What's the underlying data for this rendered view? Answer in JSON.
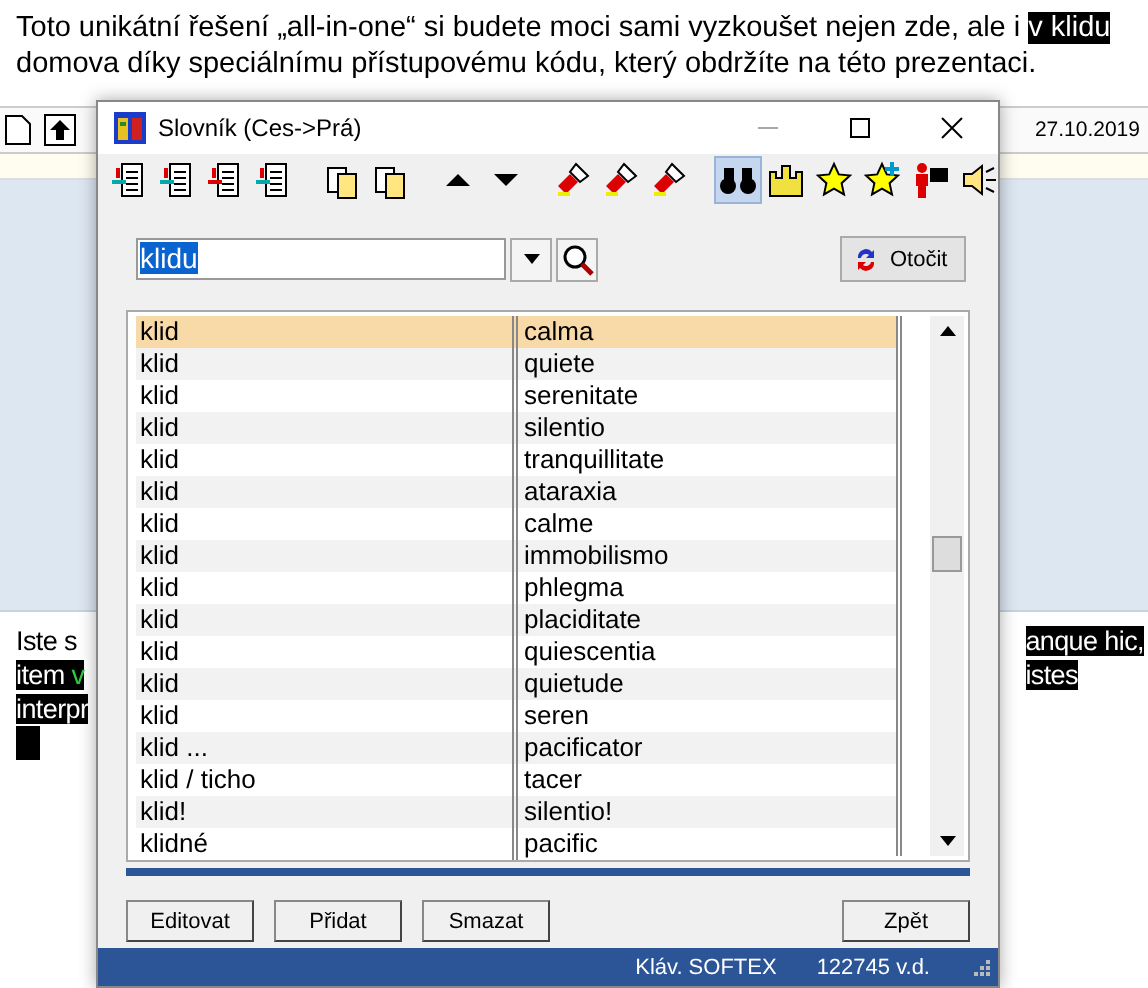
{
  "document": {
    "intro_lines": [
      [
        {
          "text": "Toto unikátní řešení „all-in-one“ si budete moci sami vyzkoušet nejen zde, ale i ",
          "highlighted": false
        },
        {
          "text": "v klidu",
          "highlighted": true
        }
      ],
      [
        {
          "text": "domova díky speciálnímu přístupovému kódu, který obdržíte na této prezentaci.",
          "highlighted": false
        }
      ]
    ],
    "date": "27.10.2019",
    "left_fragments": [
      [
        {
          "text": "Iste s",
          "highlighted": false
        }
      ],
      [
        {
          "text": "item ",
          "highlighted": true
        },
        {
          "text": "v",
          "highlighted": true,
          "green": true
        }
      ],
      [
        {
          "text": "interpr",
          "highlighted": true
        }
      ]
    ],
    "right_fragments": [
      "anque hic,",
      "istes"
    ]
  },
  "dialog": {
    "title": "Slovník (Ces->Prá)",
    "tool_groups": [
      [
        {
          "kind": "doc-in",
          "selected": false
        },
        {
          "kind": "doc-out",
          "selected": false
        },
        {
          "kind": "doc-del",
          "selected": false
        },
        {
          "kind": "doc-swap",
          "selected": false
        }
      ],
      [
        {
          "kind": "copy",
          "selected": false
        },
        {
          "kind": "copy",
          "selected": false
        }
      ],
      [
        {
          "kind": "up",
          "selected": false
        },
        {
          "kind": "down",
          "selected": false
        }
      ],
      [
        {
          "kind": "torch",
          "selected": false
        },
        {
          "kind": "torch",
          "selected": false
        },
        {
          "kind": "torch",
          "selected": false
        }
      ],
      [
        {
          "kind": "binoculars",
          "selected": true
        },
        {
          "kind": "castle",
          "selected": false
        },
        {
          "kind": "star",
          "selected": false
        },
        {
          "kind": "star-plus",
          "selected": false
        },
        {
          "kind": "person",
          "selected": false
        },
        {
          "kind": "speaker",
          "selected": false
        }
      ]
    ],
    "search_value": "klidu",
    "swap_button": "Otočit",
    "rows": [
      {
        "term": "klid",
        "translation": "calma",
        "selected": true
      },
      {
        "term": "klid",
        "translation": "quiete",
        "selected": false
      },
      {
        "term": "klid",
        "translation": "serenitate",
        "selected": false
      },
      {
        "term": "klid",
        "translation": "silentio",
        "selected": false
      },
      {
        "term": "klid",
        "translation": "tranquillitate",
        "selected": false
      },
      {
        "term": "klid",
        "translation": "ataraxia",
        "selected": false
      },
      {
        "term": "klid",
        "translation": "calme",
        "selected": false
      },
      {
        "term": "klid",
        "translation": "immobilismo",
        "selected": false
      },
      {
        "term": "klid",
        "translation": "phlegma",
        "selected": false
      },
      {
        "term": "klid",
        "translation": "placiditate",
        "selected": false
      },
      {
        "term": "klid",
        "translation": "quiescentia",
        "selected": false
      },
      {
        "term": "klid",
        "translation": "quietude",
        "selected": false
      },
      {
        "term": "klid",
        "translation": "seren",
        "selected": false
      },
      {
        "term": "klid ...",
        "translation": "pacificator",
        "selected": false
      },
      {
        "term": "klid / ticho",
        "translation": "tacer",
        "selected": false
      },
      {
        "term": "klid!",
        "translation": "silentio!",
        "selected": false
      },
      {
        "term": "klidné",
        "translation": "pacific",
        "selected": false
      }
    ],
    "buttons": [
      "Editovat",
      "Přidat",
      "Smazat"
    ],
    "back_button": "Zpět",
    "status": [
      "Kláv. SOFTEX",
      "122745 v.d."
    ]
  }
}
